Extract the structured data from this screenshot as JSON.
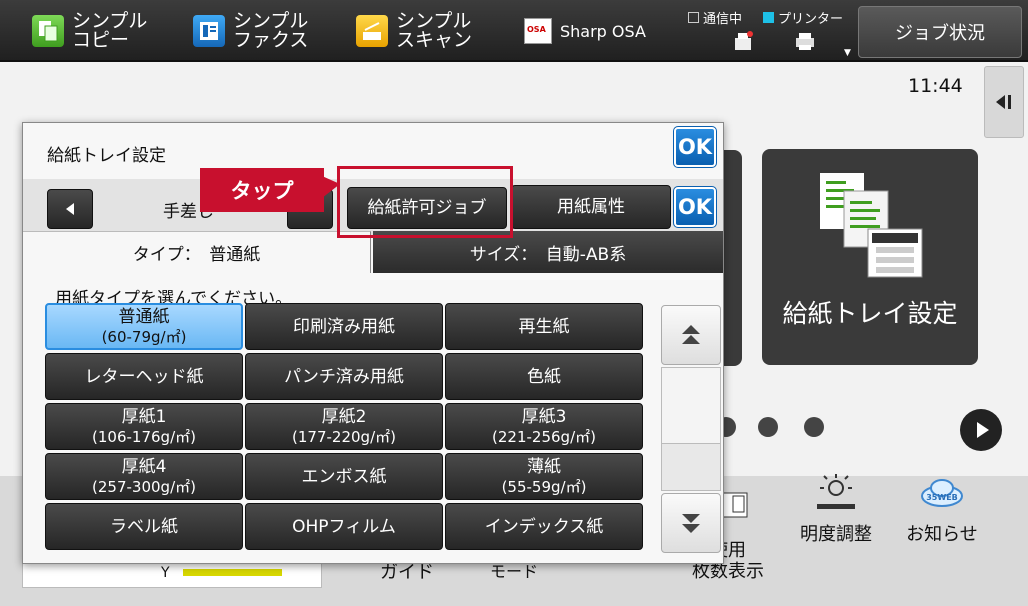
{
  "topbar": {
    "shortcuts": [
      {
        "label": "シンプル\nコピー",
        "icon": "copy-icon"
      },
      {
        "label": "シンプル\nファクス",
        "icon": "fax-icon"
      },
      {
        "label": "シンプル\nスキャン",
        "icon": "scan-icon"
      },
      {
        "label": "Sharp OSA",
        "icon": "osa-icon",
        "logo_text": "OSA"
      }
    ],
    "status": {
      "communicating": "通信中",
      "printer": "プリンター",
      "printer_active": true
    },
    "job_status": "ジョブ状況"
  },
  "clock": "11:44",
  "home": {
    "tile_label": "給紙トレイ設定",
    "bottom": {
      "count_label": "使用\n枚数表示",
      "brightness": "明度調整",
      "info": "お知らせ",
      "info_logo": "35WEB",
      "guide": "ガイド",
      "mode": "モード",
      "toner_color": "Y",
      "toner_level": 0.55
    }
  },
  "dialog": {
    "title": "給紙トレイ設定",
    "ok": "OK",
    "tray_label": "手差し",
    "btn_allowed_jobs": "給紙許可ジョブ",
    "btn_paper_attr": "用紙属性",
    "tab_type": "タイプ：　普通紙",
    "tab_size": "サイズ：　自動-AB系",
    "prompt": "用紙タイプを選んでください。",
    "paper_types": [
      {
        "line1": "普通紙",
        "line2": "(60-79g/㎡)",
        "selected": true
      },
      {
        "line1": "印刷済み用紙",
        "line2": ""
      },
      {
        "line1": "再生紙",
        "line2": ""
      },
      {
        "line1": "レターヘッド紙",
        "line2": ""
      },
      {
        "line1": "パンチ済み用紙",
        "line2": ""
      },
      {
        "line1": "色紙",
        "line2": ""
      },
      {
        "line1": "厚紙1",
        "line2": "(106-176g/㎡)"
      },
      {
        "line1": "厚紙2",
        "line2": "(177-220g/㎡)"
      },
      {
        "line1": "厚紙3",
        "line2": "(221-256g/㎡)"
      },
      {
        "line1": "厚紙4",
        "line2": "(257-300g/㎡)"
      },
      {
        "line1": "エンボス紙",
        "line2": ""
      },
      {
        "line1": "薄紙",
        "line2": "(55-59g/㎡)"
      },
      {
        "line1": "ラベル紙",
        "line2": ""
      },
      {
        "line1": "OHPフィルム",
        "line2": ""
      },
      {
        "line1": "インデックス紙",
        "line2": ""
      }
    ]
  },
  "annotation": {
    "tap": "タップ",
    "color": "#c8102e"
  }
}
